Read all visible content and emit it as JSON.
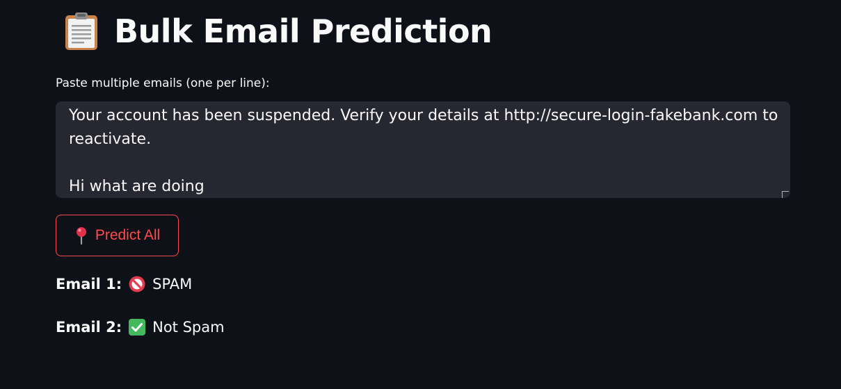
{
  "header": {
    "icon": "clipboard-icon",
    "title": "Bulk Email Prediction"
  },
  "input": {
    "label": "Paste multiple emails (one per line):",
    "lines": [
      "Your account has been suspended. Verify your details at http://secure-login-fakebank.com to",
      "reactivate.",
      "",
      "Hi what are doing"
    ]
  },
  "predict_button": {
    "icon": "pushpin-icon",
    "label": "Predict All",
    "color": "#ff4b4b"
  },
  "results": [
    {
      "label": "Email 1:",
      "icon": "prohibited-icon",
      "value": "SPAM"
    },
    {
      "label": "Email 2:",
      "icon": "check-mark-icon",
      "value": "Not Spam"
    }
  ],
  "theme": {
    "background": "#0e1117",
    "textarea_background": "#262730",
    "text": "#fafafa",
    "accent": "#ff4b4b"
  }
}
